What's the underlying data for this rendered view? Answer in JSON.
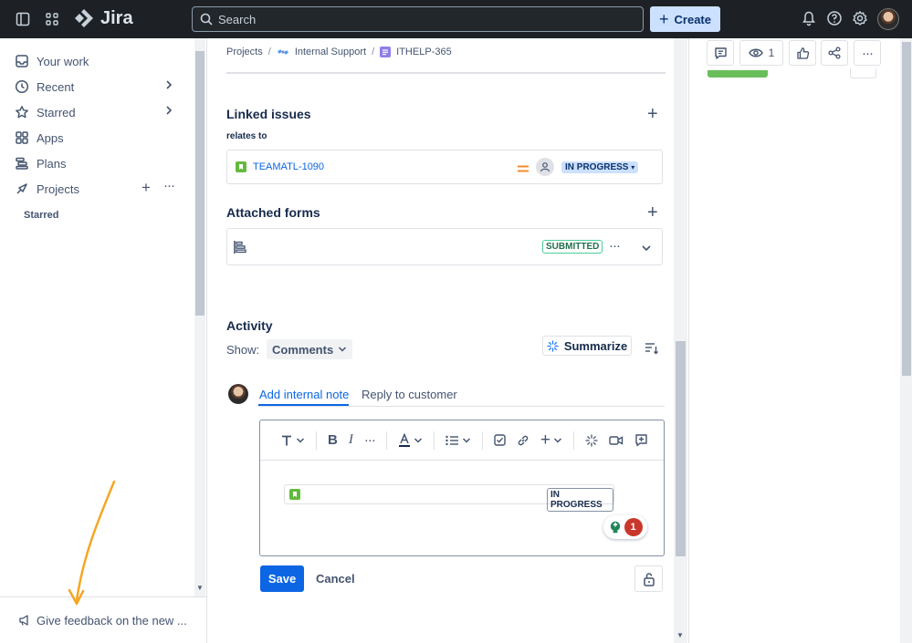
{
  "topbar": {
    "app_name": "Jira",
    "search_placeholder": "Search",
    "create_label": "Create"
  },
  "sidebar": {
    "items": [
      {
        "label": "Your work",
        "icon": "inbox-icon"
      },
      {
        "label": "Recent",
        "icon": "clock-icon"
      },
      {
        "label": "Starred",
        "icon": "star-icon"
      },
      {
        "label": "Apps",
        "icon": "apps-icon"
      },
      {
        "label": "Plans",
        "icon": "plans-icon"
      },
      {
        "label": "Projects",
        "icon": "projects-icon"
      }
    ],
    "starred_heading": "Starred",
    "feedback_label": "Give feedback on the new ..."
  },
  "breadcrumb": {
    "projects": "Projects",
    "project": "Internal Support",
    "issue": "ITHELP-365"
  },
  "linked_issues": {
    "heading": "Linked issues",
    "relation": "relates to",
    "issue_key": "TEAMATL-1090",
    "status": "IN PROGRESS"
  },
  "attached_forms": {
    "heading": "Attached forms",
    "status": "SUBMITTED"
  },
  "activity": {
    "heading": "Activity",
    "show_label": "Show:",
    "filter_value": "Comments",
    "summarize_label": "Summarize",
    "tab_internal": "Add internal note",
    "tab_reply": "Reply to customer"
  },
  "editor": {
    "inline_status": "IN PROGRESS",
    "badge_count": "1"
  },
  "actions": {
    "save_label": "Save",
    "cancel_label": "Cancel"
  },
  "right_panel": {
    "watch_count": "1"
  },
  "colors": {
    "topbar_bg": "#1d2125",
    "accent": "#0c66e4",
    "annotation_arrow": "#f5a623"
  }
}
